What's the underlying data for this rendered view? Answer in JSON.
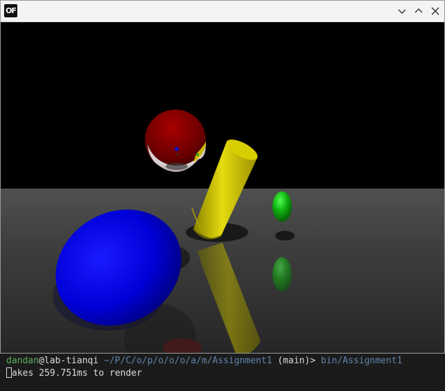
{
  "window": {
    "logo_text": "OF",
    "logo_icon": "openframeworks-logo-icon",
    "buttons": [
      "minimize-chevron-down-icon",
      "maximize-chevron-up-icon",
      "close-x-icon"
    ]
  },
  "scene": {
    "background": "#000000",
    "floor_color": "#3a3a3a",
    "objects": [
      {
        "name": "red-reflective-sphere",
        "color": "#8b0000"
      },
      {
        "name": "yellow-cylinder",
        "color": "#d4c800"
      },
      {
        "name": "green-sphere",
        "color": "#10a010"
      },
      {
        "name": "blue-sphere",
        "color": "#0000d8"
      }
    ]
  },
  "terminal": {
    "prompt_user": "dandan",
    "prompt_at_host": "@lab-tianqi",
    "prompt_path": "~/P/C/o/p/o/o/o/a/m/Assignment1",
    "prompt_branch": "(main)>",
    "command": "bin/Assignment1",
    "output": "akes 259.751ms to render"
  },
  "colors": {
    "prompt_user": "#5faf5f",
    "prompt_path": "#5f87af",
    "text": "#dcdcdc"
  }
}
